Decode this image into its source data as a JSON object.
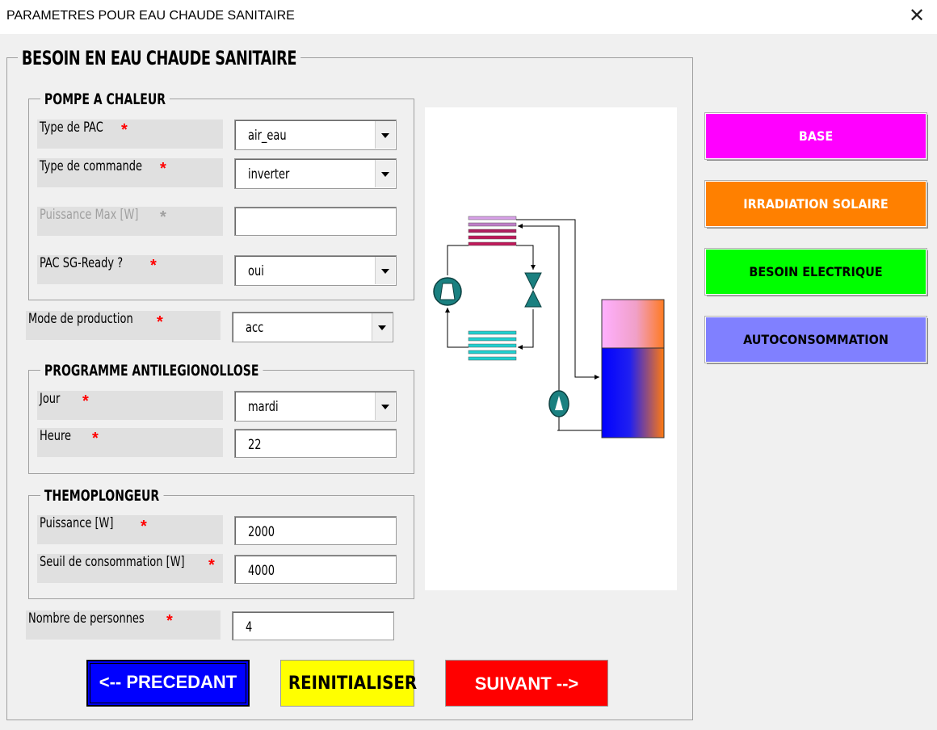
{
  "window": {
    "title": "PARAMETRES POUR EAU CHAUDE SANITAIRE",
    "close_glyph": "✕"
  },
  "main_frame": {
    "title": "BESOIN EN EAU CHAUDE SANITAIRE"
  },
  "pompe": {
    "title": "POMPE A CHALEUR",
    "type_pac": {
      "label": "Type de PAC",
      "value": "air_eau"
    },
    "type_commande": {
      "label": "Type de commande",
      "value": "inverter"
    },
    "puissance_max": {
      "label": "Puissance Max [W]",
      "value": ""
    },
    "sg_ready": {
      "label": "PAC SG-Ready ?",
      "value": "oui"
    }
  },
  "mode_production": {
    "label": "Mode de production",
    "value": "acc"
  },
  "antilegio": {
    "title": "PROGRAMME ANTILEGIONOLLOSE",
    "jour": {
      "label": "Jour",
      "value": "mardi"
    },
    "heure": {
      "label": "Heure",
      "value": "22"
    }
  },
  "thermo": {
    "title": "THEMOPLONGEUR",
    "puissance": {
      "label": "Puissance [W]",
      "value": "2000"
    },
    "seuil": {
      "label": "Seuil de consommation [W]",
      "value": "4000"
    }
  },
  "personnes": {
    "label": "Nombre de personnes",
    "value": "4"
  },
  "required_mark": "*",
  "side_buttons": {
    "base": "BASE",
    "irradiation": "IRRADIATION SOLAIRE",
    "besoin_elec": "BESOIN ELECTRIQUE",
    "autoconso": "AUTOCONSOMMATION"
  },
  "bottom_buttons": {
    "prev": "<-- PRECEDANT",
    "reset": "REINITIALISER",
    "next": "SUIVANT -->"
  },
  "colors": {
    "base": "#ff00ff",
    "irradiation": "#ff8000",
    "besoin_elec": "#00ff00",
    "autoconso": "#8080ff",
    "prev": "#0000ff",
    "reset": "#ffff00",
    "next": "#ff0000",
    "required": "#ff0000",
    "heat_pump_teal": "#1a8080",
    "condenser": "#c0185a",
    "evaporator": "#20d0d0"
  },
  "icons": {
    "close": "close-icon",
    "dropdown": "chevron-down-icon",
    "compressor": "compressor-icon",
    "valve": "expansion-valve-icon",
    "pump": "pump-icon",
    "tank": "water-tank-icon"
  }
}
